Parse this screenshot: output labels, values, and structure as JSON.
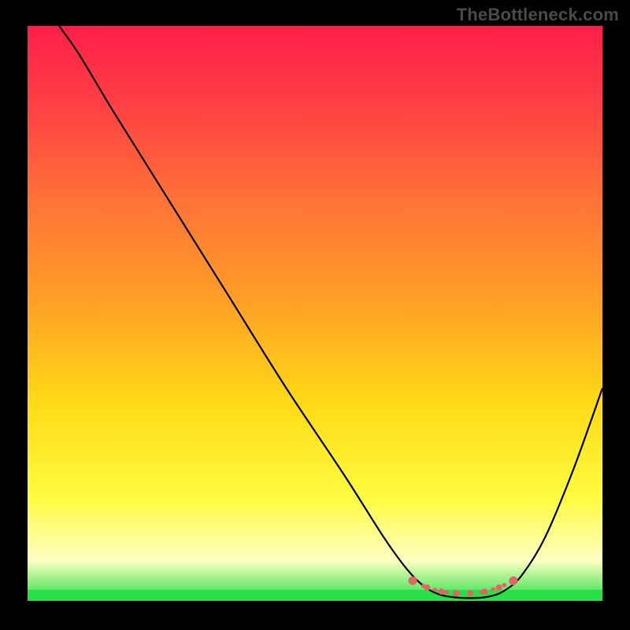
{
  "watermark": "TheBottleneck.com",
  "chart_data": {
    "type": "line",
    "title": "",
    "xlabel": "",
    "ylabel": "",
    "xlim": [
      0,
      100
    ],
    "ylim": [
      0,
      100
    ],
    "background_gradient": {
      "stops": [
        {
          "offset": 0.0,
          "color": "#ff1f4a"
        },
        {
          "offset": 0.12,
          "color": "#ff3b45"
        },
        {
          "offset": 0.3,
          "color": "#ff7138"
        },
        {
          "offset": 0.48,
          "color": "#ffa026"
        },
        {
          "offset": 0.66,
          "color": "#ffdb17"
        },
        {
          "offset": 0.82,
          "color": "#fffb40"
        },
        {
          "offset": 0.93,
          "color": "#fdfec2"
        },
        {
          "offset": 1.0,
          "color": "#2bdf48"
        }
      ]
    },
    "series": [
      {
        "name": "bottleneck-curve",
        "color": "#000000",
        "points": [
          {
            "x": 5.5,
            "y": 100
          },
          {
            "x": 9,
            "y": 95
          },
          {
            "x": 15,
            "y": 85
          },
          {
            "x": 25,
            "y": 69
          },
          {
            "x": 35,
            "y": 53
          },
          {
            "x": 45,
            "y": 37
          },
          {
            "x": 55,
            "y": 22
          },
          {
            "x": 62,
            "y": 11
          },
          {
            "x": 66,
            "y": 5.5
          },
          {
            "x": 69,
            "y": 2.5
          },
          {
            "x": 72,
            "y": 1.0
          },
          {
            "x": 76,
            "y": 0.5
          },
          {
            "x": 80,
            "y": 0.7
          },
          {
            "x": 83,
            "y": 1.8
          },
          {
            "x": 86,
            "y": 4.5
          },
          {
            "x": 90,
            "y": 11
          },
          {
            "x": 95,
            "y": 23
          },
          {
            "x": 100,
            "y": 37
          }
        ]
      },
      {
        "name": "optimal-range-markers",
        "color": "#e06666",
        "type": "scatter",
        "points": [
          {
            "x": 67,
            "y": 3.5
          },
          {
            "x": 69.5,
            "y": 2.3
          },
          {
            "x": 72,
            "y": 1.6
          },
          {
            "x": 74.5,
            "y": 1.3
          },
          {
            "x": 77,
            "y": 1.3
          },
          {
            "x": 79.5,
            "y": 1.6
          },
          {
            "x": 82,
            "y": 2.3
          },
          {
            "x": 84.5,
            "y": 3.5
          }
        ]
      }
    ],
    "annotations": []
  }
}
